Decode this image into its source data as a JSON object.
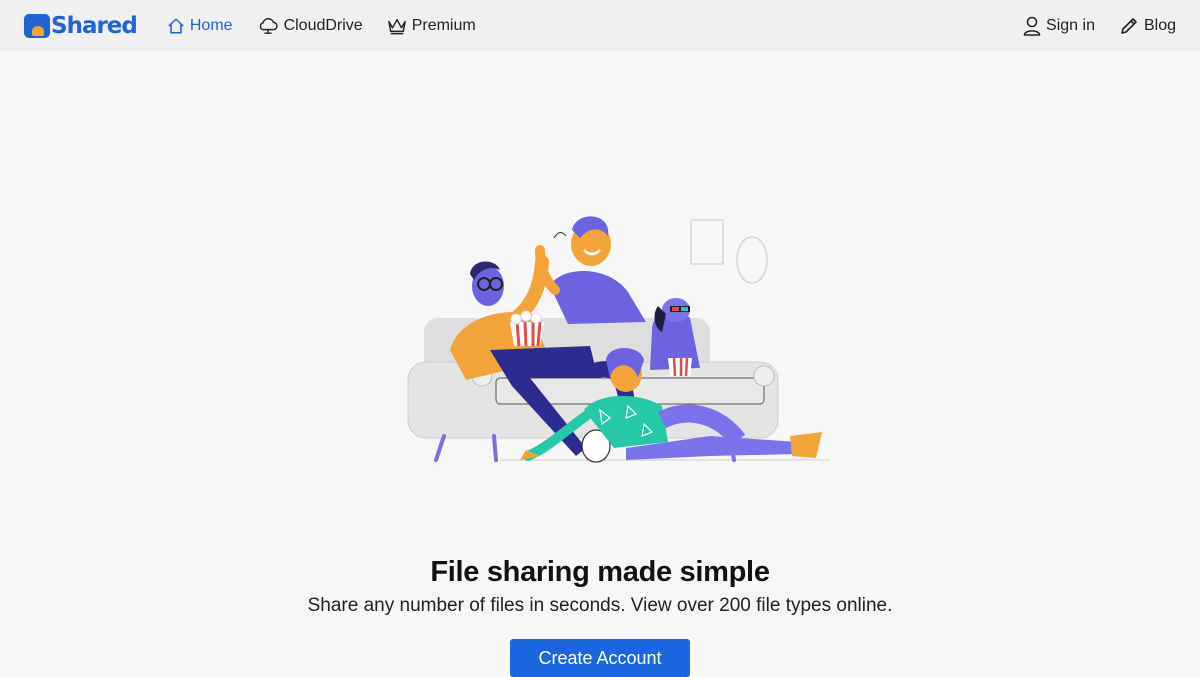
{
  "brand": {
    "logo_text": "Shared"
  },
  "nav": {
    "left": [
      {
        "label": "Home",
        "icon": "home-icon",
        "active": true
      },
      {
        "label": "CloudDrive",
        "icon": "cloud-icon",
        "active": false
      },
      {
        "label": "Premium",
        "icon": "crown-icon",
        "active": false
      }
    ],
    "right": [
      {
        "label": "Sign in",
        "icon": "user-icon"
      },
      {
        "label": "Blog",
        "icon": "pencil-icon"
      }
    ]
  },
  "hero": {
    "illustration": "people-on-couch-watching-movie",
    "headline": "File sharing made simple",
    "subline": "Share any number of files in seconds. View over 200 file types online.",
    "cta_label": "Create Account"
  },
  "colors": {
    "accent": "#1f63d9",
    "button": "#1a66e0",
    "navbar_bg": "#f0f0f2",
    "page_bg": "#f7f7f7"
  }
}
